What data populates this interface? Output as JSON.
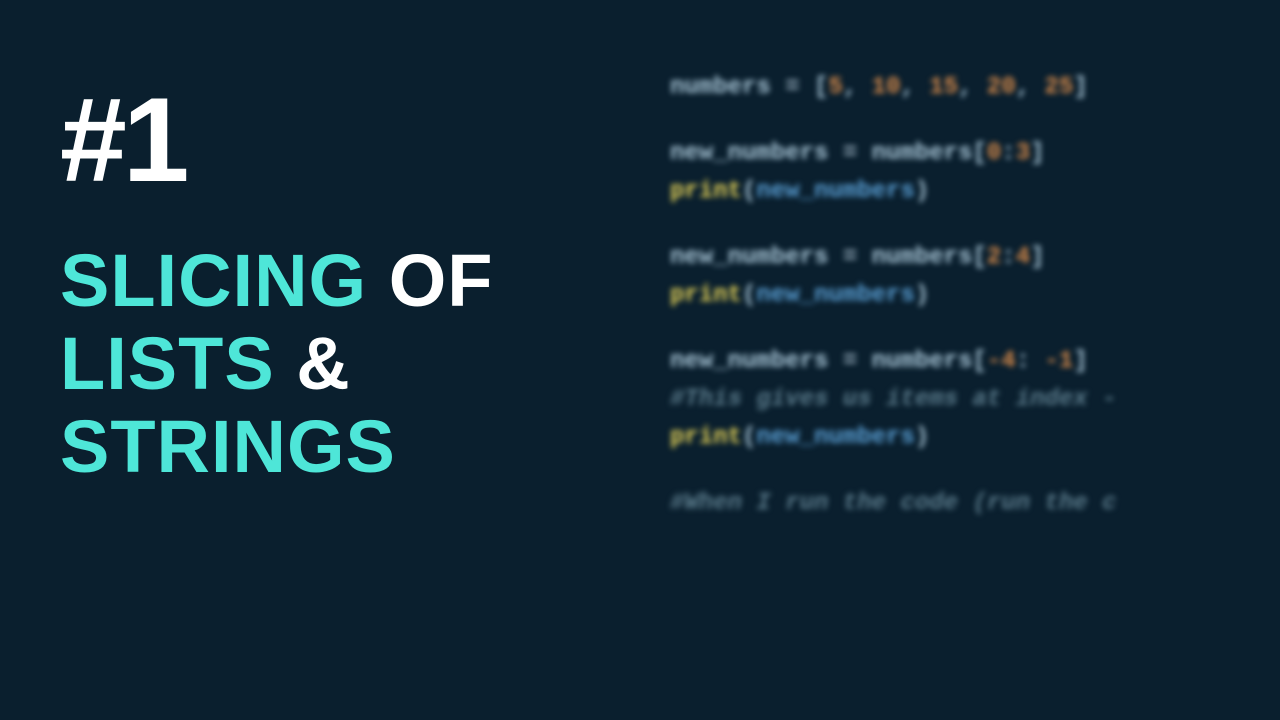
{
  "badge": "#1",
  "title": {
    "w1": "SLICING",
    "w2": "OF",
    "w3": "LISTS",
    "amp": "&",
    "w4": "STRINGS"
  },
  "code": {
    "l1_var": "numbers",
    "l1_eq": " = ",
    "l1_open": "[",
    "l1_n1": "5",
    "l1_c": ", ",
    "l1_n2": "10",
    "l1_n3": "15",
    "l1_n4": "20",
    "l1_n5": "25",
    "l1_close": "]",
    "l2_var": "new_numbers",
    "l2_eq": " = ",
    "l2_src": "numbers",
    "l2_open": "[",
    "l2_a": "0",
    "l2_colon": ":",
    "l2_b": "3",
    "l2_close": "]",
    "l3_func": "print",
    "l3_open": "(",
    "l3_arg": "new_numbers",
    "l3_close": ")",
    "l4_var": "new_numbers",
    "l4_eq": " = ",
    "l4_src": "numbers",
    "l4_open": "[",
    "l4_a": "2",
    "l4_colon": ":",
    "l4_b": "4",
    "l4_close": "]",
    "l5_func": "print",
    "l5_open": "(",
    "l5_arg": "new_numbers",
    "l5_close": ")",
    "l6_var": "new_numbers",
    "l6_eq": " = ",
    "l6_src": "numbers",
    "l6_open": "[",
    "l6_a": "-4",
    "l6_colon": ": ",
    "l6_b": "-1",
    "l6_close": "]",
    "l7_comment": "#This gives us items at index -",
    "l8_func": "print",
    "l8_open": "(",
    "l8_arg": "new_numbers",
    "l8_close": ")",
    "l9_comment": "#When I run the code (run the c"
  }
}
